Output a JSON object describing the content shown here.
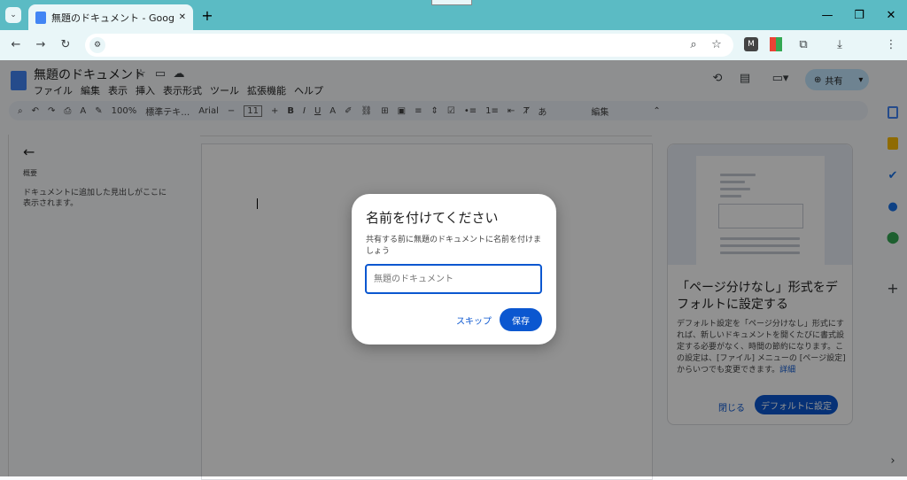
{
  "browser": {
    "tab_title": "無題のドキュメント - Google ドキュ",
    "new_tab": "+",
    "window_controls": {
      "minimize": "—",
      "restore": "❐",
      "close": "✕"
    }
  },
  "docs": {
    "title": "無題のドキュメント",
    "menu": [
      "ファイル",
      "編集",
      "表示",
      "挿入",
      "表示形式",
      "ツール",
      "拡張機能",
      "ヘルプ"
    ],
    "share_label": "共有",
    "toolbar": {
      "zoom": "100%",
      "style": "標準テキ…",
      "font": "Arial",
      "font_size": "11",
      "edit_mode": "編集"
    }
  },
  "outline": {
    "heading": "概要",
    "empty_text": "ドキュメントに追加した見出しがここに表示されます。"
  },
  "promo_card": {
    "title": "「ページ分けなし」形式をデフォルトに設定する",
    "body": "デフォルト設定を「ページ分けなし」形式にすれば、新しいドキュメントを開くたびに書式設定する必要がなく、時間の節約になります。この設定は、[ファイル] メニューの [ページ設定] からいつでも変更できます。",
    "details_link": "詳細",
    "close_label": "閉じる",
    "set_default_label": "デフォルトに設定"
  },
  "dialog": {
    "title": "名前を付けてください",
    "body": "共有する前に無題のドキュメントに名前を付けましょう",
    "input_placeholder": "無題のドキュメント",
    "skip_label": "スキップ",
    "save_label": "保存"
  },
  "colors": {
    "accent": "#0b57d0",
    "titlebar": "#5bbbc4",
    "share_bg": "#c2e7ff"
  }
}
